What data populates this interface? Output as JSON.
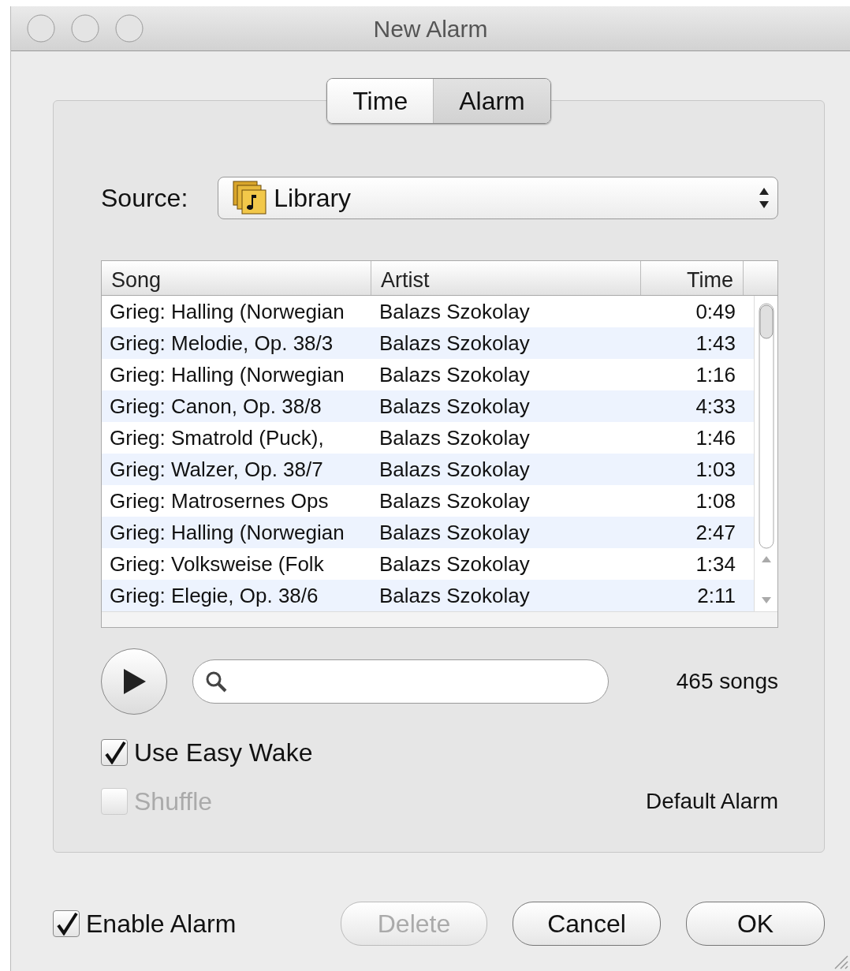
{
  "window": {
    "title": "New Alarm"
  },
  "tabs": [
    {
      "label": "Time",
      "selected": false
    },
    {
      "label": "Alarm",
      "selected": true
    }
  ],
  "source": {
    "label": "Source:",
    "value": "Library"
  },
  "table": {
    "columns": [
      "Song",
      "Artist",
      "Time"
    ],
    "rows": [
      [
        "Grieg: Halling (Norwegian",
        "Balazs Szokolay",
        "0:49"
      ],
      [
        "Grieg: Melodie, Op. 38/3",
        "Balazs Szokolay",
        "1:43"
      ],
      [
        "Grieg: Halling (Norwegian",
        "Balazs Szokolay",
        "1:16"
      ],
      [
        "Grieg: Canon, Op. 38/8",
        "Balazs Szokolay",
        "4:33"
      ],
      [
        "Grieg: Smatrold (Puck),",
        "Balazs Szokolay",
        "1:46"
      ],
      [
        "Grieg: Walzer, Op. 38/7",
        "Balazs Szokolay",
        "1:03"
      ],
      [
        "Grieg: Matrosernes Ops",
        "Balazs Szokolay",
        "1:08"
      ],
      [
        "Grieg: Halling (Norwegian",
        "Balazs Szokolay",
        "2:47"
      ],
      [
        "Grieg: Volksweise (Folk",
        "Balazs Szokolay",
        "1:34"
      ],
      [
        "Grieg: Elegie, Op. 38/6",
        "Balazs Szokolay",
        "2:11"
      ]
    ]
  },
  "song_count": "465 songs",
  "options": [
    {
      "label": "Use Easy Wake",
      "checked": true,
      "disabled": false
    },
    {
      "label": "Shuffle",
      "checked": false,
      "disabled": true
    }
  ],
  "default_alarm": "Default Alarm",
  "enable_alarm": {
    "label": "Enable Alarm",
    "checked": true
  },
  "buttons": [
    {
      "label": "Delete",
      "disabled": true
    },
    {
      "label": "Cancel",
      "disabled": false
    },
    {
      "label": "OK",
      "disabled": false
    }
  ]
}
